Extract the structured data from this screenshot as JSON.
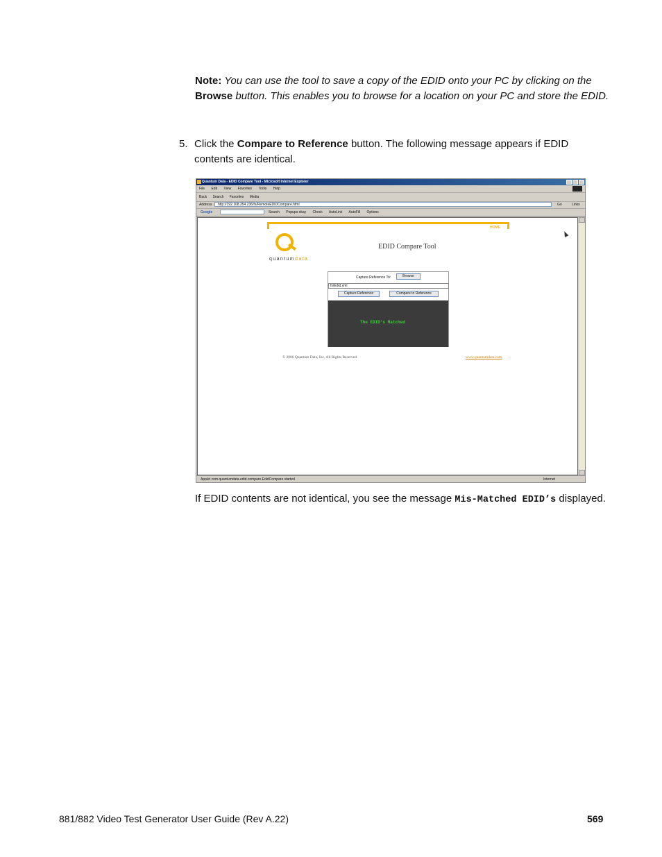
{
  "note": {
    "label": "Note:",
    "text_before": "You can use the tool to save a copy of the EDID onto your PC by clicking on the",
    "browse_word": "Browse",
    "text_after": "button. This enables you to browse for a location on your PC and store the EDID."
  },
  "step": {
    "number": "5.",
    "text_before": "Click the",
    "button_name": "Compare to Reference",
    "text_after": "button. The following message appears if EDID contents are identical."
  },
  "screenshot": {
    "window_title": "Quantum Data - EDID Compare Tool - Microsoft Internet Explorer",
    "menu": [
      "File",
      "Edit",
      "View",
      "Favorites",
      "Tools",
      "Help"
    ],
    "toolbar": [
      "Back",
      "Search",
      "Favorites",
      "Media"
    ],
    "address_label": "Address",
    "address_url": "http://192.168.254.236/fs/RemoteEDIDCompare.html",
    "go_label": "Go",
    "links_label": "Links",
    "google_label": "Google",
    "google_items": [
      "Search",
      "Popups okay",
      "Check",
      "AutoLink",
      "AutoFill",
      "Options"
    ],
    "home_link": "HOME",
    "brand_part1": "quantum",
    "brand_part2": "data",
    "tool_title": "EDID Compare Tool",
    "capture_label": "Capture Reference To:",
    "browse_button": "Browse",
    "file_path": "fs/Edid.xml",
    "capture_button": "Capture Reference",
    "compare_button": "Compare to Reference",
    "result_message": "The EDID's Matched",
    "copyright": "© 2006 Quantum Data, Inc. All Rights Reserved",
    "website": "www.quantumdata.com",
    "status_text": "Applet com.quantumdata.edid.compare.EdidCompare started",
    "zone": "Internet"
  },
  "after": {
    "text_before": "If EDID contents are not identical, you see the message",
    "code": "Mis-Matched EDID’s",
    "text_after": "displayed."
  },
  "footer": {
    "title": "881/882 Video Test Generator User Guide (Rev A.22)",
    "page": "569"
  }
}
